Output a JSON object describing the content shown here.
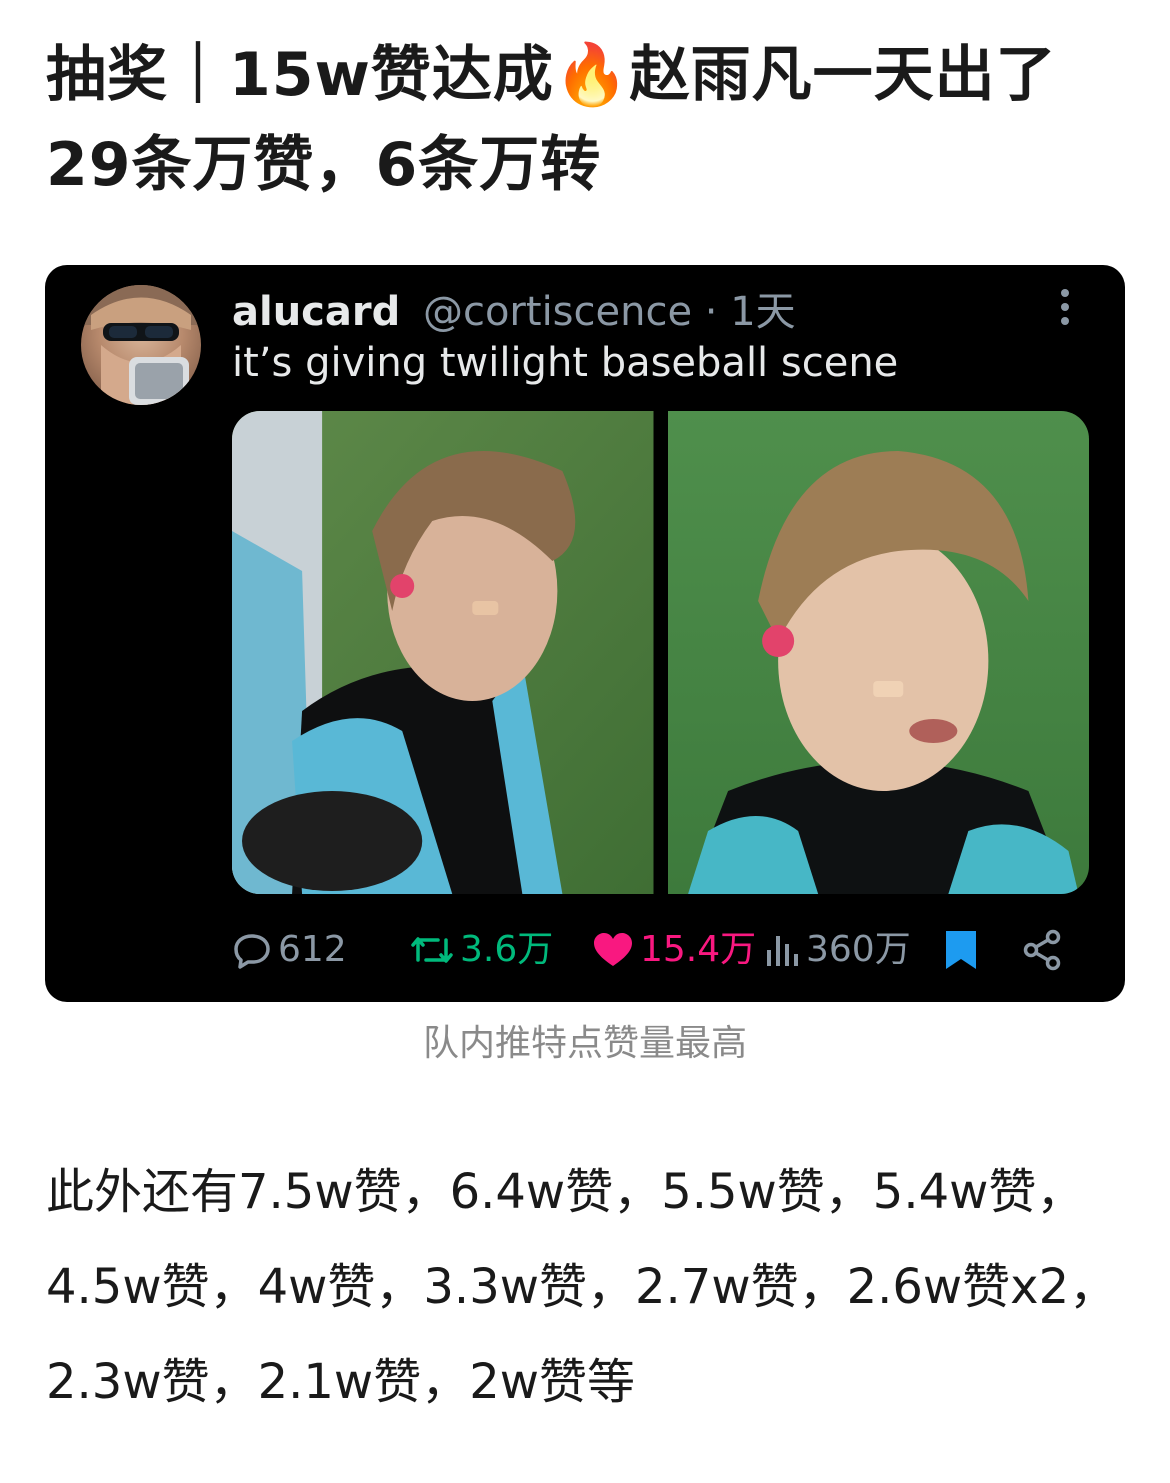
{
  "post": {
    "title_part1": "抽奖｜15w赞达成",
    "title_emoji": "🔥",
    "title_part2": "赵雨凡一天出了29条万赞，6条万转",
    "caption": "队内推特点赞量最高",
    "body": "此外还有7.5w赞，6.4w赞，5.5w赞，5.4w赞，4.5w赞，4w赞，3.3w赞，2.7w赞，2.6w赞x2，2.3w赞，2.1w赞，2w赞等"
  },
  "tweet": {
    "author_name": "alucard",
    "author_handle": "@cortiscence",
    "separator": "·",
    "time_ago": "1天",
    "text": "it’s giving twilight baseball scene",
    "stats": {
      "replies": "612",
      "retweets": "3.6万",
      "likes": "15.4万",
      "views": "360万"
    },
    "colors": {
      "card_bg": "#000000",
      "retweet": "#00ba7c",
      "like": "#f91880",
      "bookmark": "#1d9bf0",
      "muted": "#8b98a5"
    },
    "icons": [
      "more-vertical-icon",
      "reply-icon",
      "retweet-icon",
      "heart-icon",
      "views-icon",
      "bookmark-icon",
      "share-icon"
    ]
  }
}
